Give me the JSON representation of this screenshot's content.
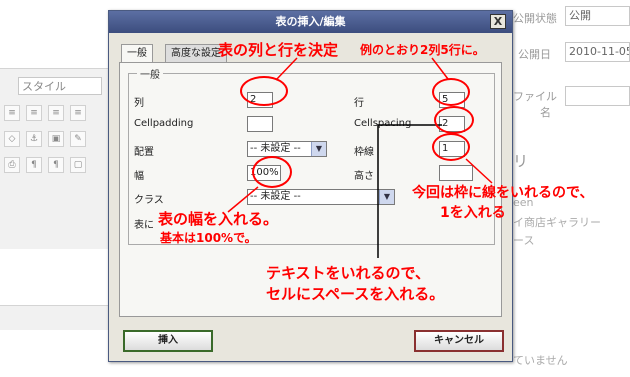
{
  "background": {
    "style_select": "スタイル",
    "right_panel": {
      "status_label": "公開状態",
      "status_value": "公開",
      "date_label": "公開日",
      "date_value": "2010-11-05",
      "file_label_1": "ファイル",
      "file_label_2": "名",
      "category_fragment": "リ",
      "item_1": "een",
      "item_2": "イ商店ギャラリー",
      "item_3": "ース",
      "footer_text": "ていません"
    }
  },
  "dialog": {
    "title": "表の挿入/編集",
    "close_label": "X",
    "tabs": [
      "一般",
      "高度な設定"
    ],
    "legend": "一般",
    "fields": {
      "cols_label": "列",
      "cols_value": "2",
      "rows_label": "行",
      "rows_value": "5",
      "cellpadding_label": "Cellpadding",
      "cellpadding_value": "",
      "cellspacing_label": "Cellspacing",
      "cellspacing_value": "2",
      "align_label": "配置",
      "align_value": "-- 未設定 --",
      "border_label": "枠線",
      "border_value": "1",
      "width_label": "幅",
      "width_value": "100%",
      "height_label": "高さ",
      "height_value": "",
      "class_label": "クラス",
      "class_value": "-- 未設定 --",
      "caption_label": "表に"
    },
    "insert_label": "挿入",
    "cancel_label": "キャンセル"
  },
  "annotations": {
    "color": "#ff0000",
    "cols_rows": "表の列と行を決定",
    "example": "例のとおり2列5行に。",
    "border_1": "今回は枠に線をいれるので、",
    "border_2": "1を入れる",
    "width_1": "表の幅を入れる。",
    "width_2": "基本は100%で。",
    "spacing_1": "テキストをいれるので、",
    "spacing_2": "セルにスペースを入れる。"
  }
}
